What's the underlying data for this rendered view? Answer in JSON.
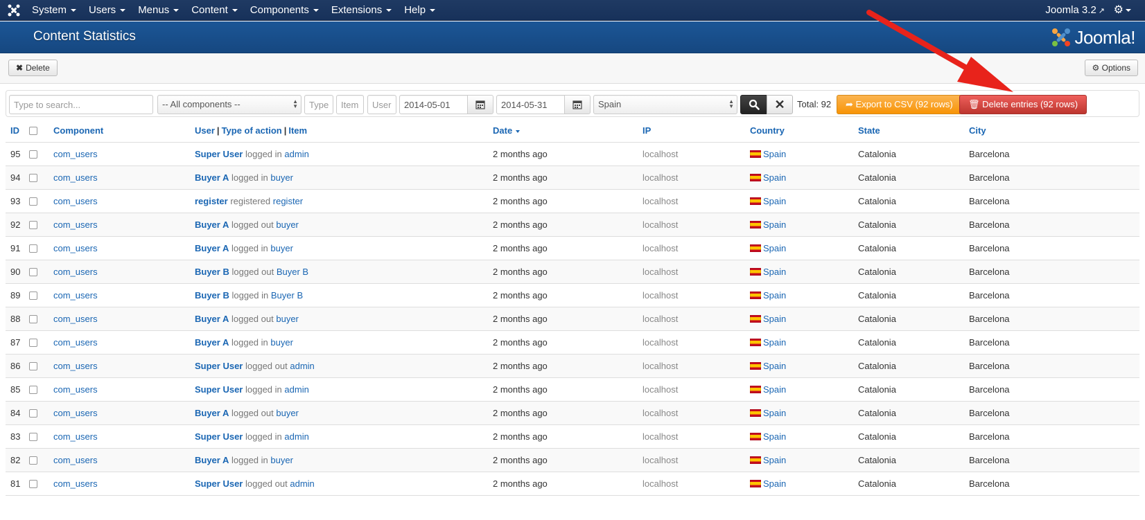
{
  "navbar": {
    "menu": [
      {
        "label": "System"
      },
      {
        "label": "Users"
      },
      {
        "label": "Menus"
      },
      {
        "label": "Content"
      },
      {
        "label": "Components"
      },
      {
        "label": "Extensions"
      },
      {
        "label": "Help"
      }
    ],
    "version": "Joomla 3.2",
    "icons": {
      "logo": "joomla-logo-icon",
      "external": "external-link-icon",
      "settings": "gear-icon"
    }
  },
  "header": {
    "title": "Content Statistics",
    "brand": "Joomla!"
  },
  "toolbar": {
    "delete_label": "Delete",
    "options_label": "Options"
  },
  "filters": {
    "search_placeholder": "Type to search...",
    "component_selected": "-- All components --",
    "type_placeholder": "Type",
    "item_placeholder": "Item",
    "user_placeholder": "User",
    "date_from": "2014-05-01",
    "date_to": "2014-05-31",
    "country_selected": "Spain",
    "total": "Total: 92",
    "export_label": "Export to CSV (92 rows)",
    "delete_entries_label": "Delete entries (92 rows)"
  },
  "table": {
    "headers": {
      "id": "ID",
      "component": "Component",
      "user": "User",
      "type": "Type of action",
      "item": "Item",
      "date": "Date",
      "ip": "IP",
      "country": "Country",
      "state": "State",
      "city": "City"
    },
    "rows": [
      {
        "id": "95",
        "component": "com_users",
        "user": "Super User",
        "action": "logged in",
        "item": "admin",
        "date": "2 months ago",
        "ip": "localhost",
        "country": "Spain",
        "state": "Catalonia",
        "city": "Barcelona"
      },
      {
        "id": "94",
        "component": "com_users",
        "user": "Buyer A",
        "action": "logged in",
        "item": "buyer",
        "date": "2 months ago",
        "ip": "localhost",
        "country": "Spain",
        "state": "Catalonia",
        "city": "Barcelona"
      },
      {
        "id": "93",
        "component": "com_users",
        "user": "register",
        "action": "registered",
        "item": "register",
        "date": "2 months ago",
        "ip": "localhost",
        "country": "Spain",
        "state": "Catalonia",
        "city": "Barcelona"
      },
      {
        "id": "92",
        "component": "com_users",
        "user": "Buyer A",
        "action": "logged out",
        "item": "buyer",
        "date": "2 months ago",
        "ip": "localhost",
        "country": "Spain",
        "state": "Catalonia",
        "city": "Barcelona"
      },
      {
        "id": "91",
        "component": "com_users",
        "user": "Buyer A",
        "action": "logged in",
        "item": "buyer",
        "date": "2 months ago",
        "ip": "localhost",
        "country": "Spain",
        "state": "Catalonia",
        "city": "Barcelona"
      },
      {
        "id": "90",
        "component": "com_users",
        "user": "Buyer B",
        "action": "logged out",
        "item": "Buyer B",
        "date": "2 months ago",
        "ip": "localhost",
        "country": "Spain",
        "state": "Catalonia",
        "city": "Barcelona"
      },
      {
        "id": "89",
        "component": "com_users",
        "user": "Buyer B",
        "action": "logged in",
        "item": "Buyer B",
        "date": "2 months ago",
        "ip": "localhost",
        "country": "Spain",
        "state": "Catalonia",
        "city": "Barcelona"
      },
      {
        "id": "88",
        "component": "com_users",
        "user": "Buyer A",
        "action": "logged out",
        "item": "buyer",
        "date": "2 months ago",
        "ip": "localhost",
        "country": "Spain",
        "state": "Catalonia",
        "city": "Barcelona"
      },
      {
        "id": "87",
        "component": "com_users",
        "user": "Buyer A",
        "action": "logged in",
        "item": "buyer",
        "date": "2 months ago",
        "ip": "localhost",
        "country": "Spain",
        "state": "Catalonia",
        "city": "Barcelona"
      },
      {
        "id": "86",
        "component": "com_users",
        "user": "Super User",
        "action": "logged out",
        "item": "admin",
        "date": "2 months ago",
        "ip": "localhost",
        "country": "Spain",
        "state": "Catalonia",
        "city": "Barcelona"
      },
      {
        "id": "85",
        "component": "com_users",
        "user": "Super User",
        "action": "logged in",
        "item": "admin",
        "date": "2 months ago",
        "ip": "localhost",
        "country": "Spain",
        "state": "Catalonia",
        "city": "Barcelona"
      },
      {
        "id": "84",
        "component": "com_users",
        "user": "Buyer A",
        "action": "logged out",
        "item": "buyer",
        "date": "2 months ago",
        "ip": "localhost",
        "country": "Spain",
        "state": "Catalonia",
        "city": "Barcelona"
      },
      {
        "id": "83",
        "component": "com_users",
        "user": "Super User",
        "action": "logged in",
        "item": "admin",
        "date": "2 months ago",
        "ip": "localhost",
        "country": "Spain",
        "state": "Catalonia",
        "city": "Barcelona"
      },
      {
        "id": "82",
        "component": "com_users",
        "user": "Buyer A",
        "action": "logged in",
        "item": "buyer",
        "date": "2 months ago",
        "ip": "localhost",
        "country": "Spain",
        "state": "Catalonia",
        "city": "Barcelona"
      },
      {
        "id": "81",
        "component": "com_users",
        "user": "Super User",
        "action": "logged out",
        "item": "admin",
        "date": "2 months ago",
        "ip": "localhost",
        "country": "Spain",
        "state": "Catalonia",
        "city": "Barcelona"
      }
    ]
  },
  "annotation": {
    "arrow_color": "#e8231b"
  },
  "colors": {
    "navbar": "#1f3a63",
    "header": "#1b5696",
    "link": "#1a66b3",
    "export": "#f89406",
    "danger": "#bd362f"
  }
}
